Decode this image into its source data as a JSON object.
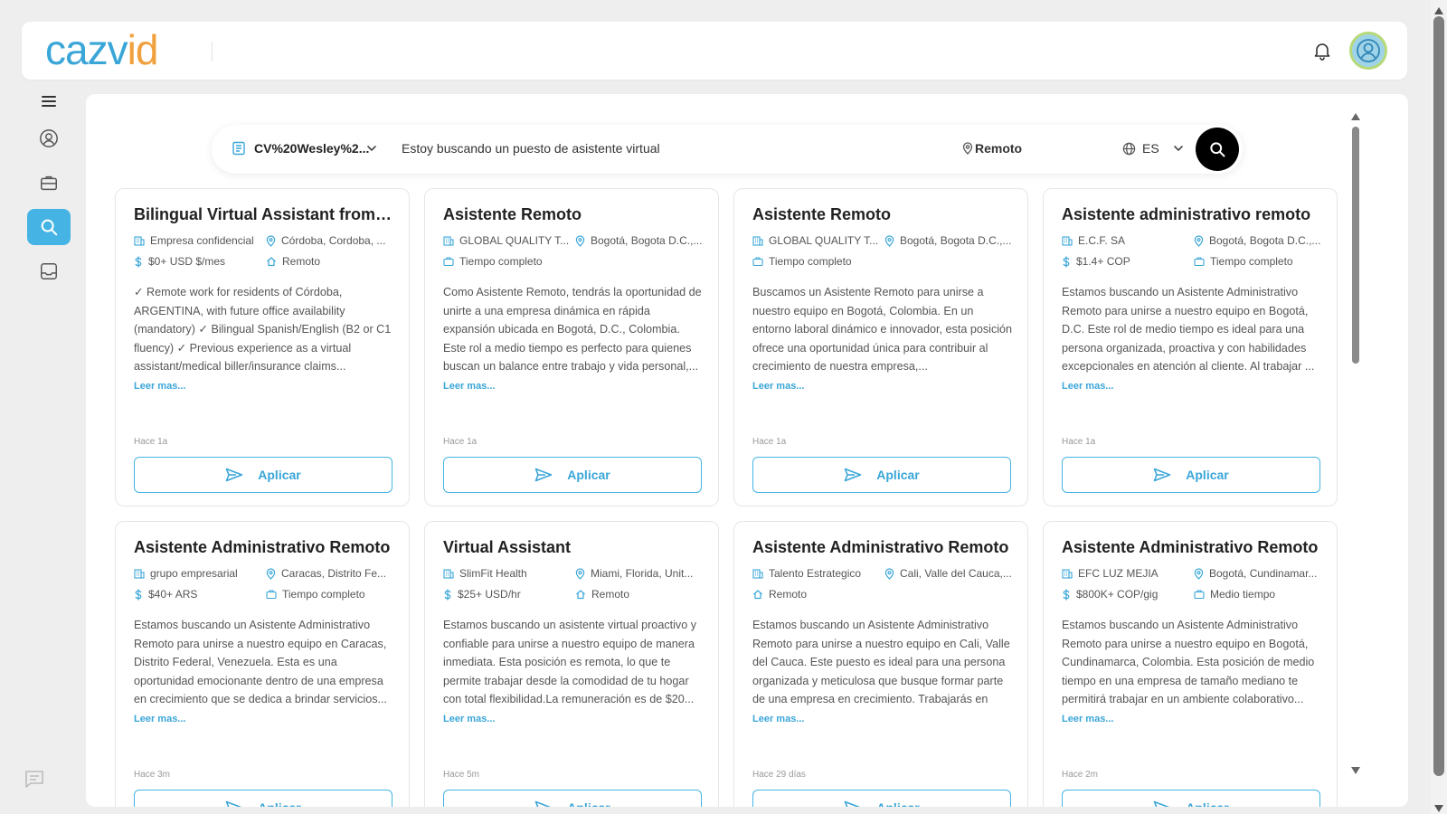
{
  "header": {
    "logo_part1": "cazv",
    "logo_part2": "id"
  },
  "search": {
    "cv_name": "CV%20Wesley%2...",
    "query": "Estoy buscando un puesto de asistente virtual",
    "location": "Remoto",
    "language": "ES"
  },
  "common": {
    "read_more": "Leer mas...",
    "apply": "Aplicar"
  },
  "jobs": [
    {
      "title": "Bilingual Virtual Assistant from Co...",
      "company": "Empresa confidencial",
      "location": "Córdoba, Cordoba, ...",
      "salary": "$0+ USD $/mes",
      "type": "Remoto",
      "type_icon": "home-icon",
      "description": "✓ Remote work for residents of Córdoba, ARGENTINA, with future office availability (mandatory) ✓ Bilingual Spanish/English (B2 or C1 fluency) ✓ Previous experience as a virtual assistant/medical biller/insurance claims...",
      "posted": "Hace 1a"
    },
    {
      "title": "Asistente Remoto",
      "company": "GLOBAL QUALITY T...",
      "location": "Bogotá, Bogota D.C.,...",
      "salary": "",
      "type": "Tiempo completo",
      "type_icon": "briefcase-icon",
      "description": "Como Asistente Remoto, tendrás la oportunidad de unirte a una empresa dinámica en rápida expansión ubicada en Bogotá, D.C., Colombia. Este rol a medio tiempo es perfecto para quienes buscan un balance entre trabajo y vida personal,...",
      "posted": "Hace 1a"
    },
    {
      "title": "Asistente Remoto",
      "company": "GLOBAL QUALITY T...",
      "location": "Bogotá, Bogota D.C.,...",
      "salary": "",
      "type": "Tiempo completo",
      "type_icon": "briefcase-icon",
      "description": "Buscamos un Asistente Remoto para unirse a nuestro equipo en Bogotá, Colombia. En un entorno laboral dinámico e innovador, esta posición ofrece una oportunidad única para contribuir al crecimiento de nuestra empresa,...",
      "posted": "Hace 1a"
    },
    {
      "title": "Asistente administrativo remoto",
      "company": "E.C.F. SA",
      "location": "Bogotá, Bogota D.C.,...",
      "salary": "$1.4+ COP",
      "type": "Tiempo completo",
      "type_icon": "briefcase-icon",
      "description": "Estamos buscando un Asistente Administrativo Remoto para unirse a nuestro equipo en Bogotá, D.C. Este rol de medio tiempo es ideal para una persona organizada, proactiva y con habilidades excepcionales en atención al cliente. Al trabajar ...",
      "posted": "Hace 1a"
    },
    {
      "title": "Asistente Administrativo Remoto",
      "company": "grupo empresarial",
      "location": "Caracas, Distrito Fe...",
      "salary": "$40+ ARS",
      "type": "Tiempo completo",
      "type_icon": "briefcase-icon",
      "description": "Estamos buscando un Asistente Administrativo Remoto para unirse a nuestro equipo en Caracas, Distrito Federal, Venezuela. Esta es una oportunidad emocionante dentro de una empresa en crecimiento que se dedica a brindar servicios...",
      "posted": "Hace 3m"
    },
    {
      "title": "Virtual Assistant",
      "company": "SlimFit Health",
      "location": "Miami, Florida, Unit...",
      "salary": "$25+ USD/hr",
      "type": "Remoto",
      "type_icon": "home-icon",
      "description": "Estamos buscando un asistente virtual proactivo y confiable para unirse a nuestro equipo de manera inmediata. Esta posición es remota, lo que te permite trabajar desde la comodidad de tu hogar con total flexibilidad.La remuneración es de $20...",
      "posted": "Hace 5m"
    },
    {
      "title": "Asistente Administrativo Remoto",
      "company": "Talento Estrategico",
      "location": "Cali, Valle del Cauca,...",
      "salary": "",
      "type": "Remoto",
      "type_icon": "home-icon",
      "description": "Estamos buscando un Asistente Administrativo Remoto para unirse a nuestro equipo en Cali, Valle del Cauca. Este puesto es ideal para una persona organizada y meticulosa que busque formar parte de una empresa en crecimiento. Trabajarás en un...",
      "posted": "Hace 29 días"
    },
    {
      "title": "Asistente Administrativo Remoto",
      "company": "EFC LUZ MEJIA",
      "location": "Bogotá, Cundinamar...",
      "salary": "$800K+ COP/gig",
      "type": "Medio tiempo",
      "type_icon": "briefcase-icon",
      "description": "Estamos buscando un Asistente Administrativo Remoto para unirse a nuestro equipo en Bogotá, Cundinamarca, Colombia. Esta posición de medio tiempo en una empresa de tamaño mediano te permitirá trabajar en un ambiente colaborativo...",
      "posted": "Hace 2m"
    }
  ]
}
